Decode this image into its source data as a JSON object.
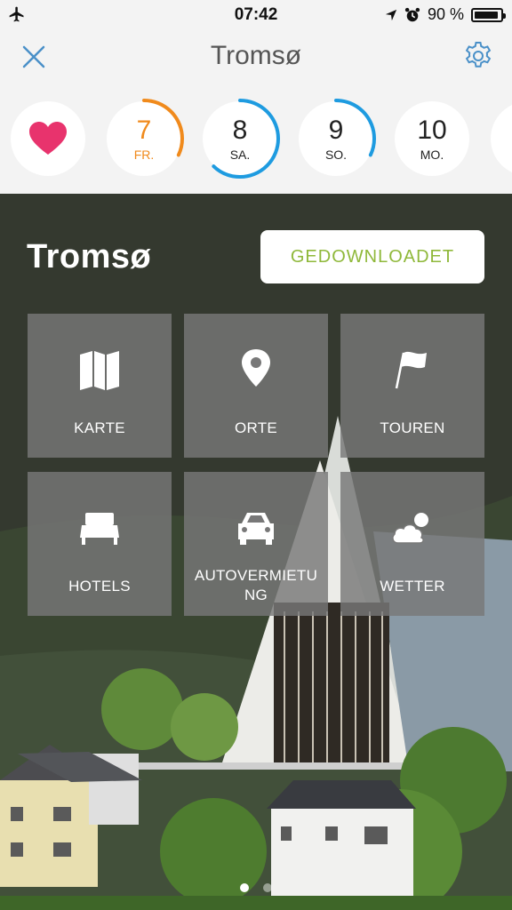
{
  "status_bar": {
    "time": "07:42",
    "battery_percent": "90 %"
  },
  "header": {
    "title": "Tromsø"
  },
  "days": [
    {
      "num": "7",
      "label": "FR.",
      "color": "#f08a1c",
      "progress": 0.32
    },
    {
      "num": "8",
      "label": "SA.",
      "color": "#1e9be0",
      "progress": 0.62
    },
    {
      "num": "9",
      "label": "SO.",
      "color": "#1e9be0",
      "progress": 0.32
    },
    {
      "num": "10",
      "label": "MO.",
      "color": "#ffffff",
      "progress": 0
    }
  ],
  "favorite": {
    "icon": "heart-icon",
    "color": "#e8336d"
  },
  "hero": {
    "title": "Tromsø",
    "download_label": "GEDOWNLOADET"
  },
  "tiles": [
    {
      "label": "KARTE",
      "icon": "map-icon"
    },
    {
      "label": "ORTE",
      "icon": "location-pin-icon"
    },
    {
      "label": "TOUREN",
      "icon": "flag-icon"
    },
    {
      "label": "HOTELS",
      "icon": "bed-icon"
    },
    {
      "label": "AUTOVERMIETU\nNG",
      "icon": "car-icon"
    },
    {
      "label": "WETTER",
      "icon": "weather-icon"
    }
  ],
  "colors": {
    "accent_green": "#8fb83a",
    "accent_blue": "#1e9be0",
    "accent_orange": "#f08a1c",
    "header_bg": "#f3f3f3"
  }
}
